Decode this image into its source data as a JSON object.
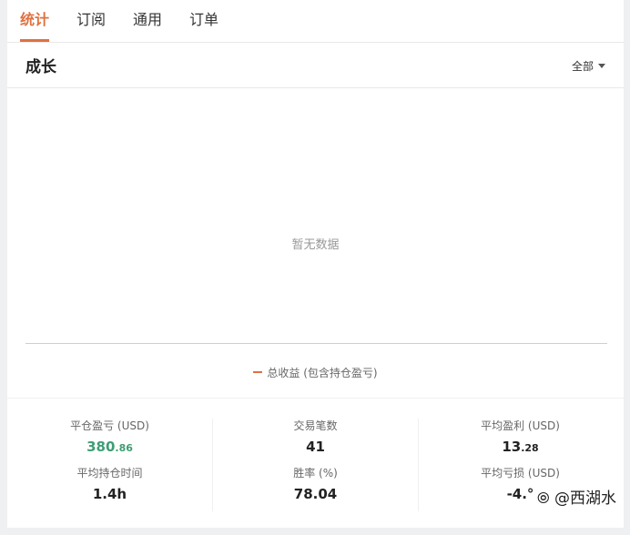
{
  "tabs": [
    {
      "label": "统计",
      "active": true
    },
    {
      "label": "订阅",
      "active": false
    },
    {
      "label": "通用",
      "active": false
    },
    {
      "label": "订单",
      "active": false
    }
  ],
  "section": {
    "title": "成长",
    "filter": "全部"
  },
  "chart": {
    "empty_text": "暂无数据",
    "legend": "总收益 (包含持仓盈亏)"
  },
  "stats": {
    "closed_pnl": {
      "label": "平仓盈亏 (USD)",
      "int": "380",
      "dec": ".86"
    },
    "avg_hold": {
      "label": "平均持仓时间",
      "value": "1.4h"
    },
    "trades": {
      "label": "交易笔数",
      "value": "41"
    },
    "win_rate": {
      "label": "胜率 (%)",
      "value": "78.04"
    },
    "avg_profit": {
      "label": "平均盈利 (USD)",
      "int": "13",
      "dec": ".28"
    },
    "avg_loss": {
      "label": "平均亏损 (USD)",
      "value": "-4.°"
    }
  },
  "watermark": "⦾ @西湖水",
  "colors": {
    "accent": "#e0713f",
    "positive": "#3f9d74"
  }
}
